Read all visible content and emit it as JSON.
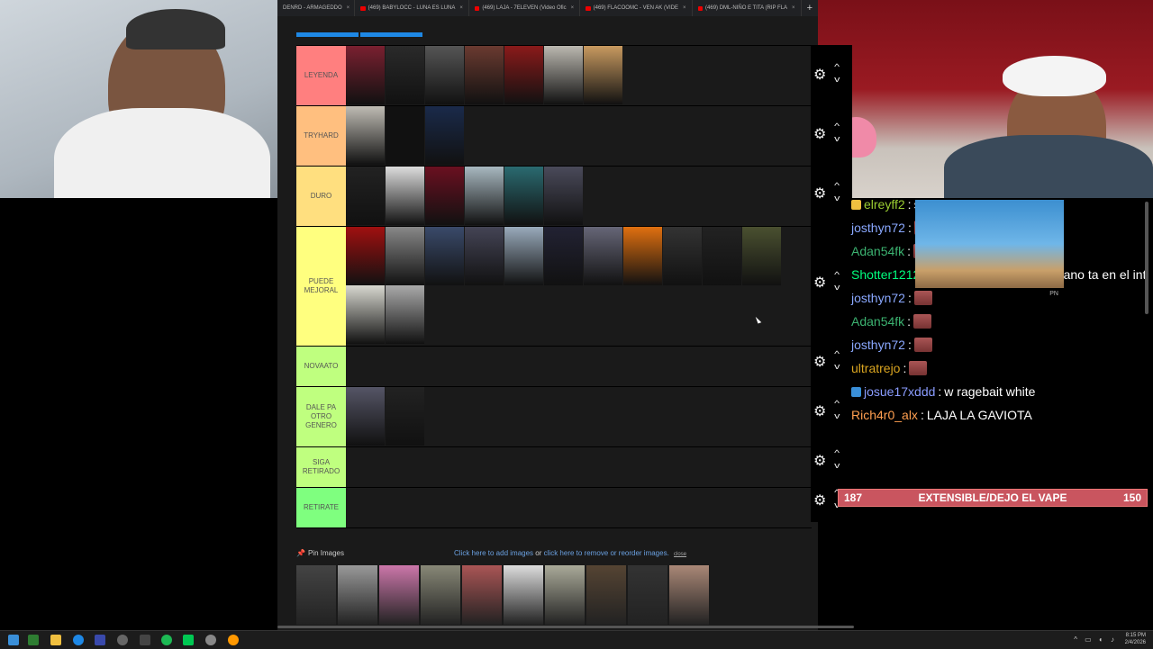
{
  "browser": {
    "tabs": [
      {
        "label": "DENRD - ARMAGEDDO"
      },
      {
        "label": "(469) BABYLOCC - LUNA ES LUNA"
      },
      {
        "label": "(469) LAJA - 7ELEVEN (Video Ofic"
      },
      {
        "label": "(469) FLACOOMC - VEN AK (VIDE"
      },
      {
        "label": "(469) DML-NIÑO E TITA (RIP FLA"
      }
    ],
    "new_tab": "+",
    "close_glyph": "×"
  },
  "tiers": [
    {
      "label": "LEYENDA",
      "color": "#ff7f7f",
      "items": [
        "#7a2030",
        "#2a2a2a",
        "#555",
        "#6a3a30",
        "#8a1a1a",
        "#bbb8b0",
        "#c89a60"
      ]
    },
    {
      "label": "TRYHARD",
      "color": "#ffbf7f",
      "items": [
        "#bfbcb4",
        "#111",
        "#1a2a4a"
      ]
    },
    {
      "label": "DURO",
      "color": "#ffdf7f",
      "items": [
        "#222",
        "#ddd",
        "#6a1020",
        "#a8b8c0",
        "#2a6a70",
        "#4a4a5a"
      ]
    },
    {
      "label": "PUEDE MEJORAL",
      "color": "#ffff7f",
      "items": [
        "#a01010",
        "#888",
        "#3a4a6a",
        "#445",
        "#9ab",
        "#223",
        "#667",
        "#e07010",
        "#333",
        "#222",
        "#4a5030",
        "#d8d8d0",
        "#aaa"
      ]
    },
    {
      "label": "NOVAATO",
      "color": "#bfff7f",
      "items": []
    },
    {
      "label": "DALE PA OTRO GENERO",
      "color": "#bfff7f",
      "items": [
        "#556",
        "#222"
      ]
    },
    {
      "label": "SIGA RETIRADO",
      "color": "#bfff7f",
      "items": []
    },
    {
      "label": "RETIRATE",
      "color": "#7fff7f",
      "items": []
    }
  ],
  "pin_bar": {
    "pin_label": "Pin Images",
    "add_link": "Click here to add images",
    "or_text": "or",
    "remove_link": "click here to remove or reorder images.",
    "close_label": "close"
  },
  "pool": [
    "#444",
    "#999",
    "#c7a",
    "#887",
    "#a55",
    "#ddd",
    "#aa9",
    "#543",
    "#333",
    "#a87"
  ],
  "chat": {
    "messages": [
      {
        "user": "elreyff2",
        "color": "#9acd32",
        "text": "snanajaj",
        "emote": false
      },
      {
        "user": "josthyn72",
        "color": "#8aa8ff",
        "text": "",
        "emote": true
      },
      {
        "user": "Adan54fk",
        "color": "#3cb371",
        "text": "",
        "emote": true
      },
      {
        "user": "Shotter1212",
        "color": "#00ff7f",
        "text": "blacky donde ta tu hermano ta en el int",
        "emote": false
      },
      {
        "user": "josthyn72",
        "color": "#8aa8ff",
        "text": "",
        "emote": true
      },
      {
        "user": "Adan54fk",
        "color": "#3cb371",
        "text": "",
        "emote": true
      },
      {
        "user": "josthyn72",
        "color": "#8aa8ff",
        "text": "",
        "emote": true
      },
      {
        "user": "ultratrejo",
        "color": "#daa520",
        "text": "",
        "emote": true
      },
      {
        "user": "josue17xddd",
        "color": "#8a9cff",
        "text": "w ragebait white",
        "emote": false
      },
      {
        "user": "Rich4r0_alx",
        "color": "#ff9f50",
        "text": "LAJA LA GAVIOTA",
        "emote": false
      }
    ],
    "overlay_caption": "PN"
  },
  "goal": {
    "left": "187",
    "label": "EXTENSIBLE/DEJO EL VAPE",
    "right": "150"
  },
  "taskbar": {
    "time": "8:15 PM",
    "date": "2/4/2026"
  }
}
